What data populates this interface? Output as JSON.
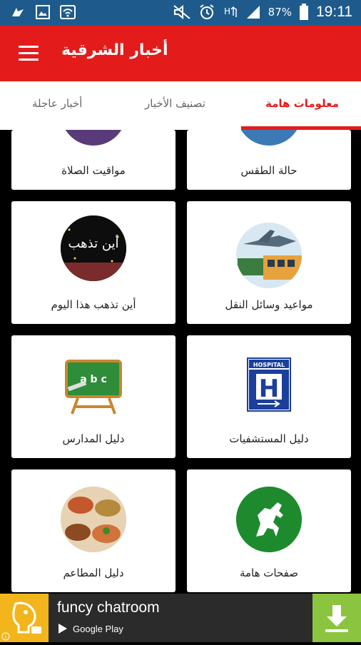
{
  "status_bar": {
    "battery": "87%",
    "time": "19:11"
  },
  "app_bar": {
    "title": "أخبار الشرقية"
  },
  "tabs": [
    {
      "label": "معلومات هامة",
      "active": true
    },
    {
      "label": "تصنيف الأخبار",
      "active": false
    },
    {
      "label": "أخبار عاجلة",
      "active": false
    }
  ],
  "grid": {
    "cards": [
      {
        "label": "حالة الطقس",
        "icon": "weather-icon"
      },
      {
        "label": "مواقيت الصلاة",
        "icon": "prayer-times-icon"
      },
      {
        "label": "مواعيد وسائل النقل",
        "icon": "transport-icon"
      },
      {
        "label": "أين تذهب هذا اليوم",
        "icon": "where-to-go-icon",
        "image_text": "أين تذهب"
      },
      {
        "label": "دليل المستشفيات",
        "icon": "hospital-sign-icon",
        "image_text": "HOSPITAL"
      },
      {
        "label": "دليل المدارس",
        "icon": "chalkboard-icon",
        "image_text": "a b c"
      },
      {
        "label": "صفحات هامة",
        "icon": "horse-icon"
      },
      {
        "label": "دليل المطاعم",
        "icon": "food-icon"
      }
    ]
  },
  "ad": {
    "title": "funcy chatroom",
    "store": "Google Play"
  },
  "colors": {
    "accent": "#e41b1b",
    "status_bar": "#1e5b8c",
    "ad_download": "#8bc53f"
  }
}
